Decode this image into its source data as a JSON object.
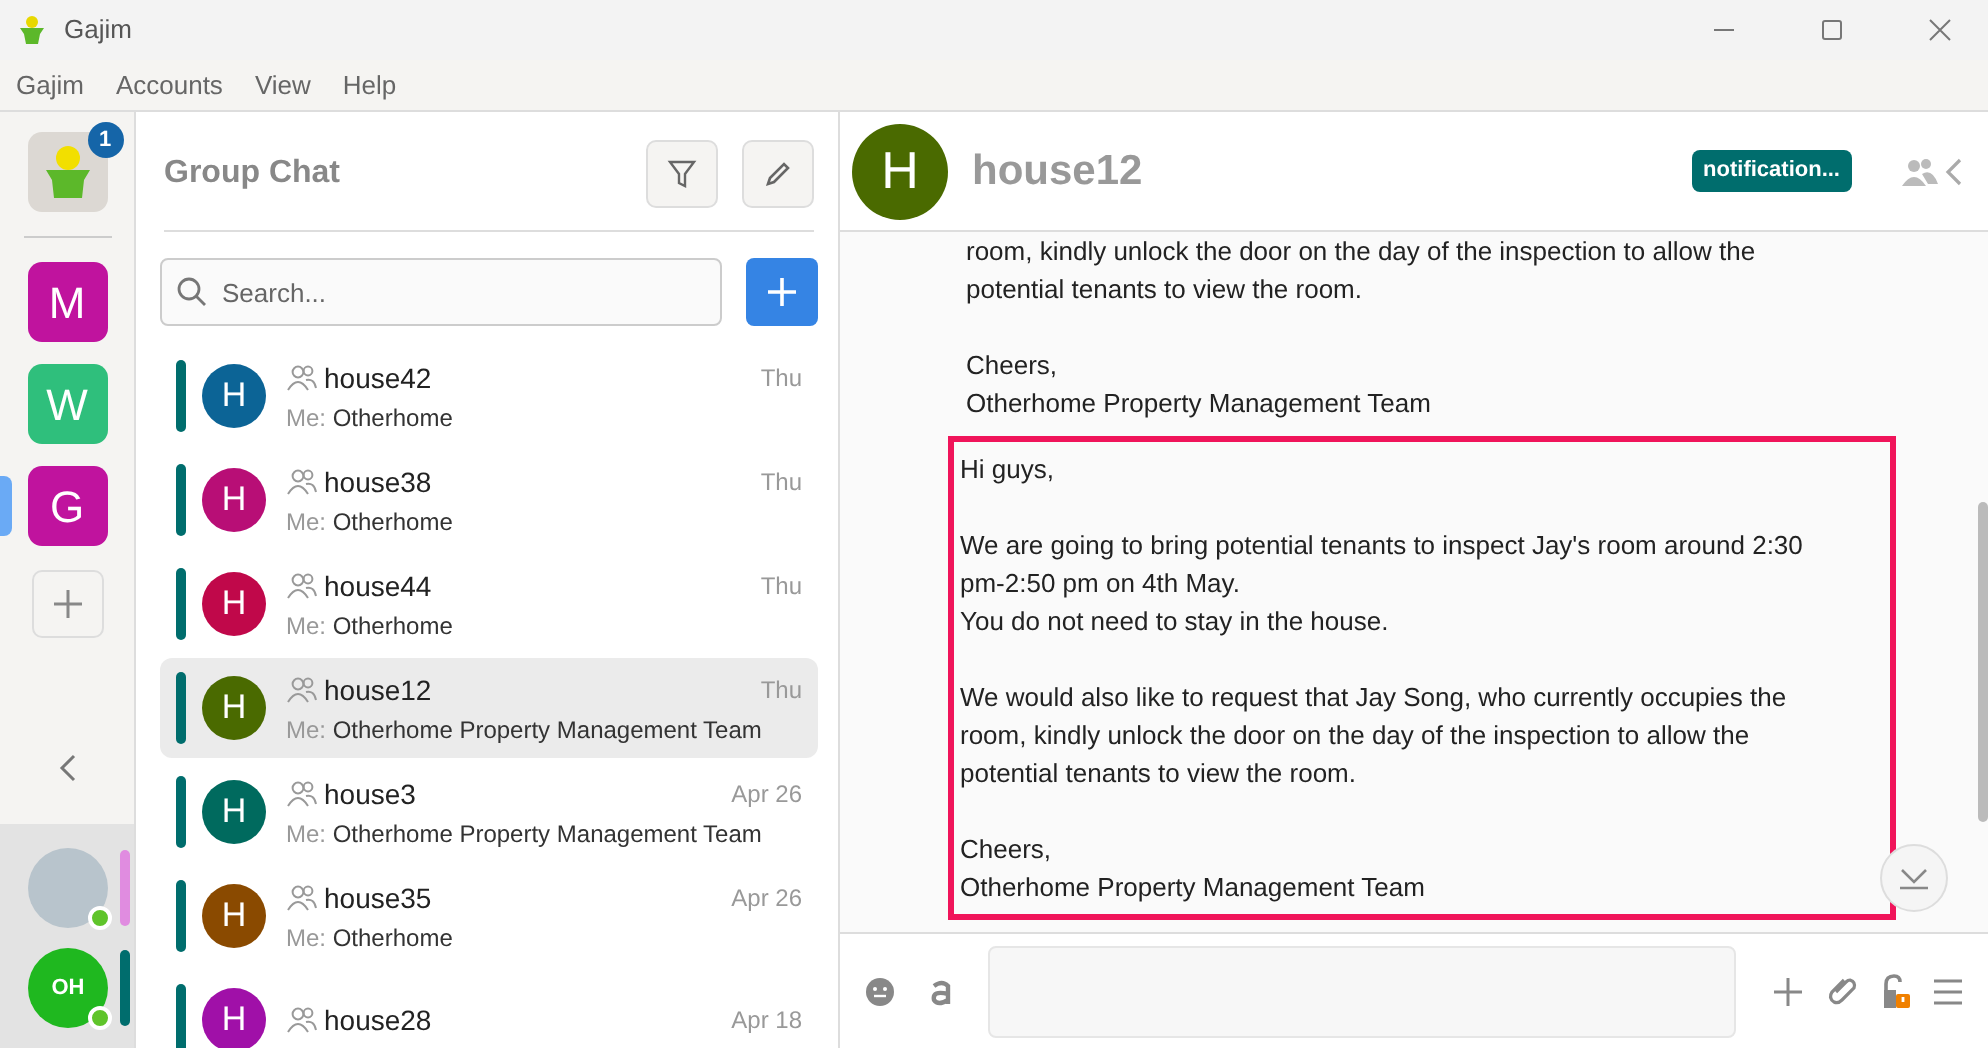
{
  "window": {
    "title": "Gajim"
  },
  "menu": [
    "Gajim",
    "Accounts",
    "View",
    "Help"
  ],
  "rail": {
    "badge": "1",
    "workspaces": [
      {
        "letter": "M",
        "color": "#c0139e",
        "selected": false
      },
      {
        "letter": "W",
        "color": "#2fbf7c",
        "selected": false
      },
      {
        "letter": "G",
        "color": "#c0139e",
        "selected": true
      }
    ],
    "accounts": [
      {
        "kind": "photo",
        "color": "#e08ce0",
        "online": true
      },
      {
        "kind": "logo",
        "text": "OH",
        "color": "#006d6d",
        "online": true
      }
    ]
  },
  "list": {
    "title": "Group Chat",
    "search": {
      "placeholder": "Search..."
    },
    "chats": [
      {
        "letter": "H",
        "name": "house42",
        "time": "Thu",
        "preview_prefix": "Me:",
        "preview": "Otherhome",
        "color": "#0c6496",
        "selected": false
      },
      {
        "letter": "H",
        "name": "house38",
        "time": "Thu",
        "preview_prefix": "Me:",
        "preview": "Otherhome",
        "color": "#b80e76",
        "selected": false
      },
      {
        "letter": "H",
        "name": "house44",
        "time": "Thu",
        "preview_prefix": "Me:",
        "preview": "Otherhome",
        "color": "#c0084a",
        "selected": false
      },
      {
        "letter": "H",
        "name": "house12",
        "time": "Thu",
        "preview_prefix": "Me:",
        "preview": "Otherhome Property Management Team",
        "color": "#4a6a00",
        "selected": true
      },
      {
        "letter": "H",
        "name": "house3",
        "time": "Apr 26",
        "preview_prefix": "Me:",
        "preview": "Otherhome Property Management Team",
        "color": "#006a5e",
        "selected": false
      },
      {
        "letter": "H",
        "name": "house35",
        "time": "Apr 26",
        "preview_prefix": "Me:",
        "preview": "Otherhome",
        "color": "#8a4a00",
        "selected": false
      },
      {
        "letter": "H",
        "name": "house28",
        "time": "Apr 18",
        "color": "#a010a8",
        "selected": false
      }
    ]
  },
  "chat": {
    "avatar": {
      "letter": "H",
      "color": "#4a6a00"
    },
    "title": "house12",
    "badge": "notification...",
    "messages": [
      {
        "text": "room, kindly unlock the door on the day of the inspection to allow the\npotential tenants to view the room.\n\nCheers,\nOtherhome Property Management Team",
        "highlighted": false
      },
      {
        "text": "Hi guys,\n\nWe are going to bring potential tenants to inspect Jay's room around 2:30\npm-2:50 pm on 4th May.\nYou do not need to stay in the house.\n\nWe would also like to request that Jay Song, who currently occupies the\nroom, kindly unlock the door on the day of the inspection to allow the\npotential tenants to view the room.\n\nCheers,\nOtherhome Property Management Team",
        "highlighted": true
      }
    ]
  }
}
